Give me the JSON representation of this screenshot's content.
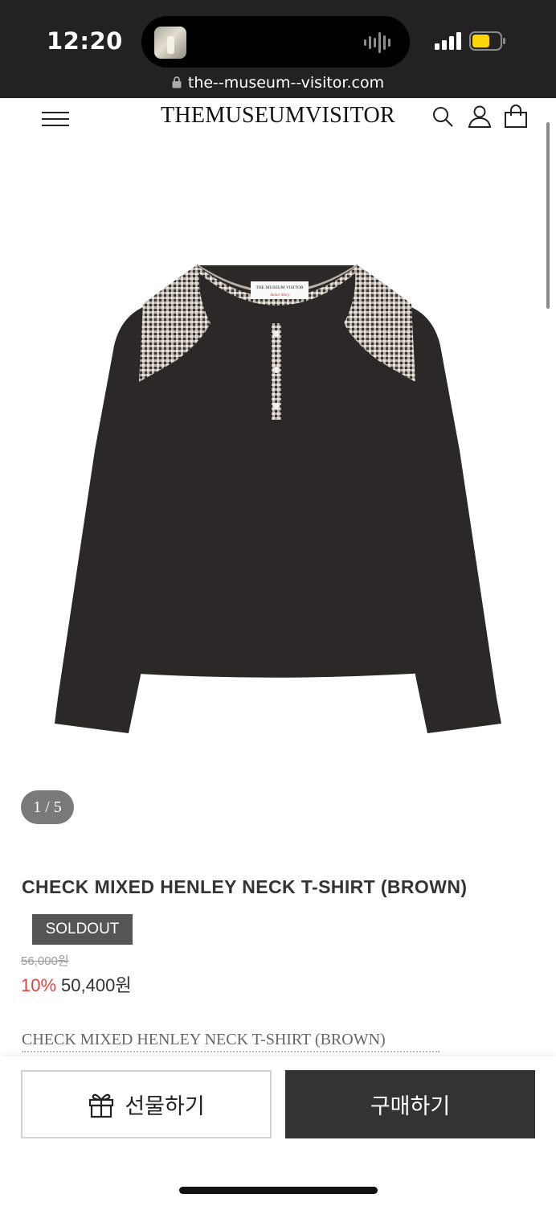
{
  "status_bar": {
    "time": "12:20",
    "url": "the--museum--visitor.com"
  },
  "header": {
    "logo": "THEMUSEUMVISITOR",
    "icons": [
      "menu-icon",
      "search-icon",
      "user-icon",
      "shopping-bag-icon"
    ]
  },
  "gallery": {
    "counter": "1 / 5",
    "label_text": [
      "THE MUSEUM VISITOR",
      "Junior Story"
    ],
    "colors": {
      "body": "#2c2827",
      "check": "#b7b0a6"
    }
  },
  "product": {
    "title": "CHECK MIXED HENLEY NECK T-SHIRT (BROWN)",
    "badge": "SOLDOUT",
    "original_price": "56,000원",
    "discount": "10%",
    "price": "50,400원",
    "description": "CHECK MIXED HENLEY NECK T-SHIRT (BROWN)"
  },
  "actions": {
    "gift_label": "선물하기",
    "buy_label": "구매하기"
  },
  "colors": {
    "accent_discount": "#e0463e",
    "buy_button": "#333333",
    "badge_bg": "#555555"
  }
}
